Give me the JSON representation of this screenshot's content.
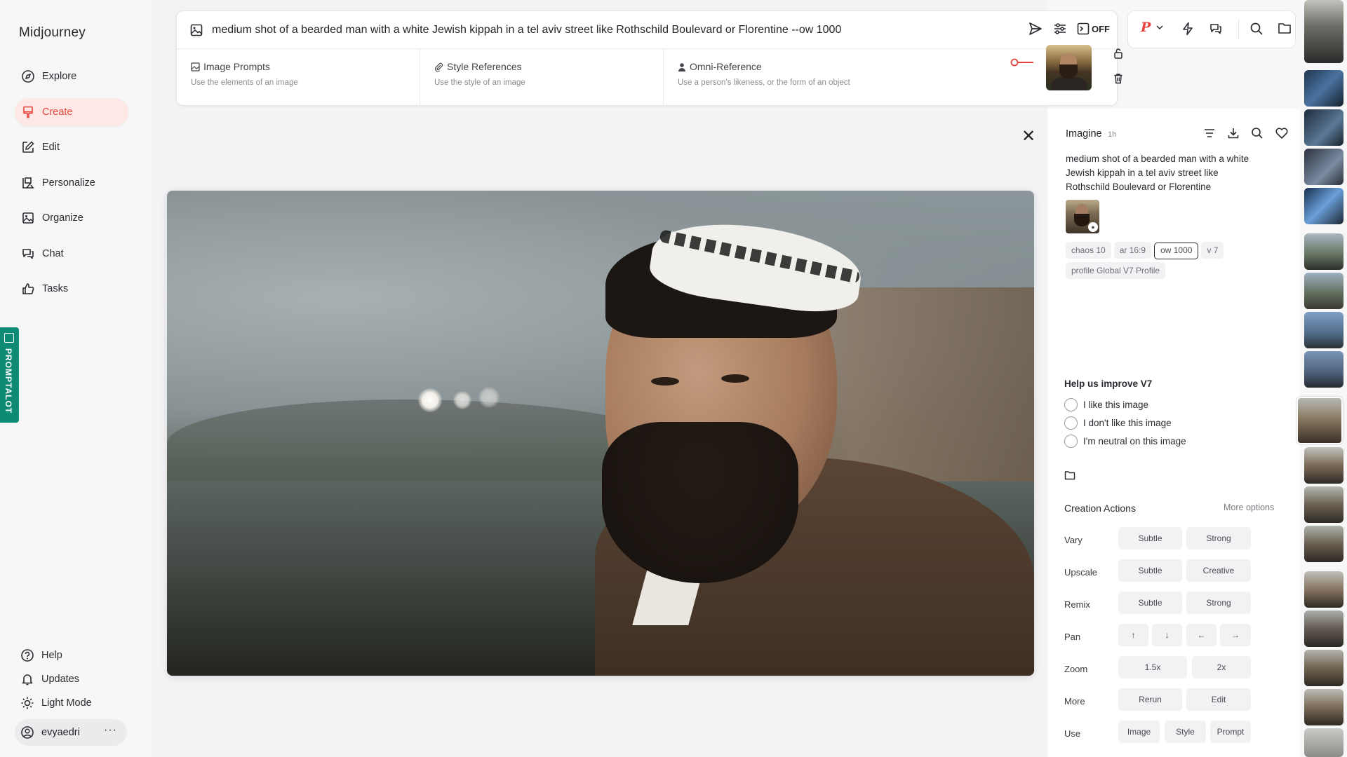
{
  "app": {
    "title": "Midjourney"
  },
  "nav": [
    {
      "label": "Explore",
      "icon": "compass-icon"
    },
    {
      "label": "Create",
      "icon": "brush-icon",
      "active": true
    },
    {
      "label": "Edit",
      "icon": "edit-icon"
    },
    {
      "label": "Personalize",
      "icon": "personalize-icon"
    },
    {
      "label": "Organize",
      "icon": "image-icon"
    },
    {
      "label": "Chat",
      "icon": "chat-icon"
    },
    {
      "label": "Tasks",
      "icon": "thumbs-up-icon"
    }
  ],
  "bottom_nav": [
    {
      "label": "Help",
      "icon": "help-icon"
    },
    {
      "label": "Updates",
      "icon": "bell-icon"
    },
    {
      "label": "Light Mode",
      "icon": "sun-icon"
    }
  ],
  "user": {
    "name": "evyaedri",
    "menu": "···"
  },
  "extension": {
    "label": "PROMPTALOT"
  },
  "prompt": {
    "text": "medium shot of a bearded man with a white Jewish kippah in a tel aviv street like Rothschild Boulevard or Florentine --ow 1000",
    "off_label": "OFF"
  },
  "references": [
    {
      "title": "Image Prompts",
      "subtitle": "Use the elements of an image",
      "icon": "image-icon"
    },
    {
      "title": "Style References",
      "subtitle": "Use the style of an image",
      "icon": "paperclip-icon"
    },
    {
      "title": "Omni-Reference",
      "subtitle": "Use a person's likeness, or the form of an object",
      "icon": "person-icon"
    }
  ],
  "detail": {
    "heading": "Imagine",
    "time": "1h",
    "prompt": "medium shot of a bearded man with a white Jewish kippah in a tel aviv street like Rothschild Boulevard or Florentine",
    "chips": [
      "chaos 10",
      "ar 16:9",
      "ow 1000",
      "v 7",
      "profile Global V7 Profile"
    ],
    "selected_chip": "ow 1000",
    "help_title": "Help us improve V7",
    "feedback": [
      "I like this image",
      "I don't like this image",
      "I'm neutral on this image"
    ],
    "creation_title": "Creation Actions",
    "more_options": "More options",
    "actions": [
      {
        "label": "Vary",
        "buttons": [
          "Subtle",
          "Strong"
        ]
      },
      {
        "label": "Upscale",
        "buttons": [
          "Subtle",
          "Creative"
        ]
      },
      {
        "label": "Remix",
        "buttons": [
          "Subtle",
          "Strong"
        ]
      },
      {
        "label": "Pan",
        "buttons": [
          "↑",
          "↓",
          "←",
          "→"
        ]
      },
      {
        "label": "Zoom",
        "buttons": [
          "1.5x",
          "2x"
        ]
      },
      {
        "label": "More",
        "buttons": [
          "Rerun",
          "Edit"
        ]
      },
      {
        "label": "Use",
        "buttons": [
          "Image",
          "Style",
          "Prompt"
        ]
      }
    ]
  },
  "colors": {
    "accent": "#e5443c",
    "active_bg": "#fde8e6",
    "extension": "#0f8a74"
  }
}
